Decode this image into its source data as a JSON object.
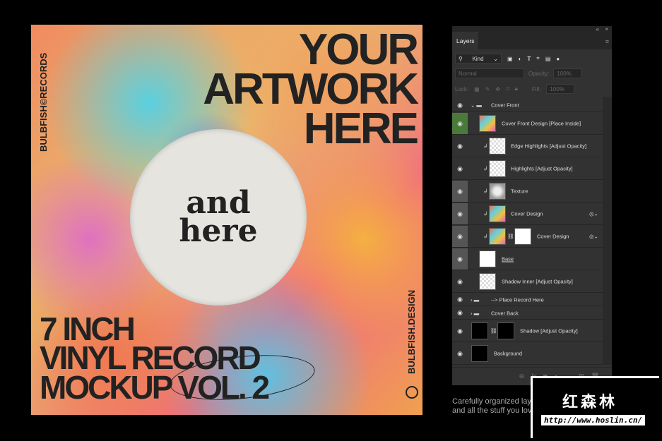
{
  "artwork": {
    "headline": [
      "YOUR",
      "ARTWORK",
      "HERE"
    ],
    "label_text": [
      "and",
      "here"
    ],
    "title": [
      "7 INCH",
      "VINYL RECORD",
      "MOCKUP VOL. 2"
    ],
    "side_left": "BULBFISH©RECORDS",
    "side_right": "BULBFISH.DESIGN"
  },
  "panel": {
    "tab": "Layers",
    "collapse": "«",
    "close": "×",
    "menu": "≡",
    "filter": {
      "kind": "Kind",
      "icons": [
        "image-filter",
        "adjustment-filter",
        "type-filter",
        "shape-filter",
        "smart-object-filter"
      ]
    },
    "blend_mode": "Normal",
    "opacity_label": "Opacity:",
    "opacity": "100%",
    "lock_label": "Lock:",
    "fill_label": "Fill:",
    "fill": "100%",
    "layers": [
      {
        "name": "Cover Front",
        "type": "group",
        "expanded": true
      },
      {
        "name": "Cover Front Design [Place Inside]",
        "type": "smart",
        "selected": true
      },
      {
        "name": "Edge Highlights [Adjust Opacity]",
        "clipped": true
      },
      {
        "name": "Highlights [Adjust Opacity]",
        "clipped": true
      },
      {
        "name": "Texture",
        "clipped": true
      },
      {
        "name": "Cover Design",
        "clipped": true
      },
      {
        "name": "Cover Design",
        "clipped": true
      },
      {
        "name": "Base"
      },
      {
        "name": "Shadow Inner [Adjust Opacity]"
      },
      {
        "name": "--> Place Record Here",
        "type": "group"
      },
      {
        "name": "Cover Back",
        "type": "group"
      },
      {
        "name": "Shadow [Adjust Opacity]"
      },
      {
        "name": "Background"
      }
    ],
    "footer_icons": [
      "link",
      "fx",
      "mask",
      "adjustment",
      "folder",
      "new-layer",
      "trash"
    ]
  },
  "caption": [
    "Carefully organized layers, smart objects,",
    "and all the stuff you love"
  ],
  "watermark": {
    "name": "红森林",
    "url": "http://www.hoslin.cn/"
  }
}
